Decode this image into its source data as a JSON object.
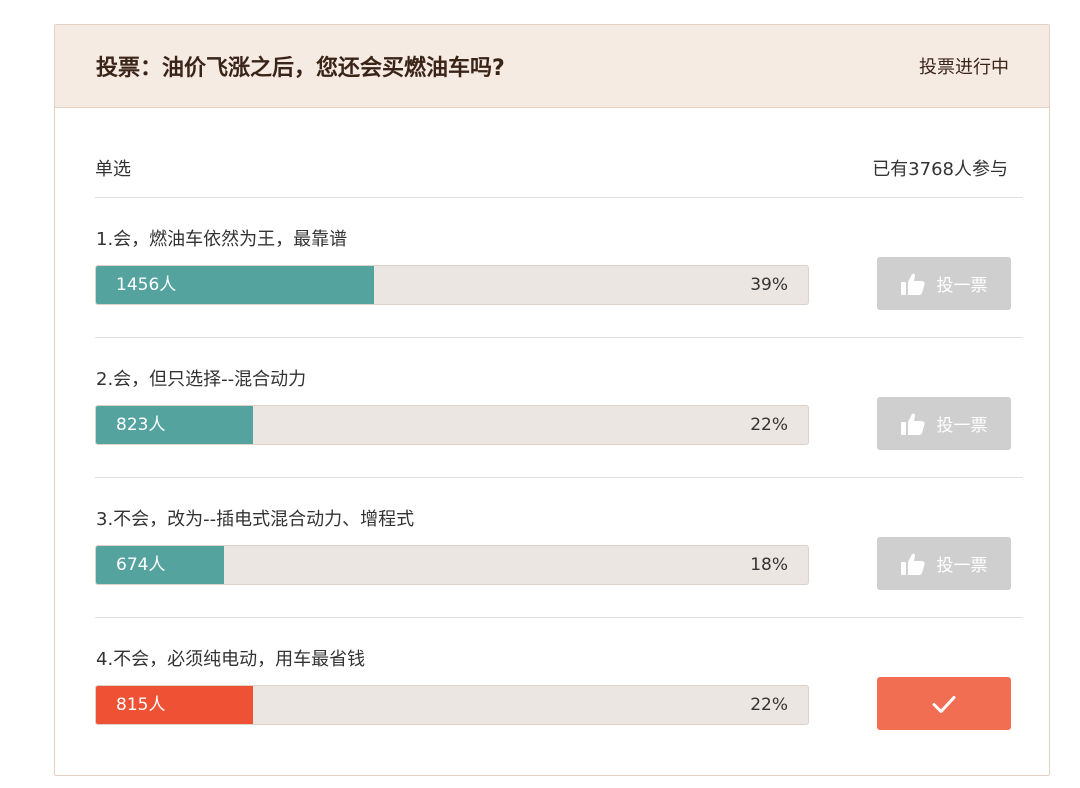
{
  "poll": {
    "title": "投票：油价飞涨之后，您还会买燃油车吗?",
    "status": "投票进行中",
    "mode": "单选",
    "participants": "已有3768人参与",
    "vote_label": "投一票",
    "options": [
      {
        "label": "1.会，燃油车依然为王，最靠谱",
        "count": "1456人",
        "percent": "39%",
        "share": 0.39,
        "selected": false
      },
      {
        "label": "2.会，但只选择--混合动力",
        "count": "823人",
        "percent": "22%",
        "share": 0.22,
        "selected": false
      },
      {
        "label": "3.不会，改为--插电式混合动力、增程式",
        "count": "674人",
        "percent": "18%",
        "share": 0.18,
        "selected": false
      },
      {
        "label": "4.不会，必须纯电动，用车最省钱",
        "count": "815人",
        "percent": "22%",
        "share": 0.22,
        "selected": true
      }
    ]
  },
  "colors": {
    "header_bg": "#f6ebe3",
    "bar_fill": "#55a39f",
    "bar_selected": "#ee5133",
    "vote_button": "#cfcfcf",
    "voted_button": "#f16e53"
  }
}
